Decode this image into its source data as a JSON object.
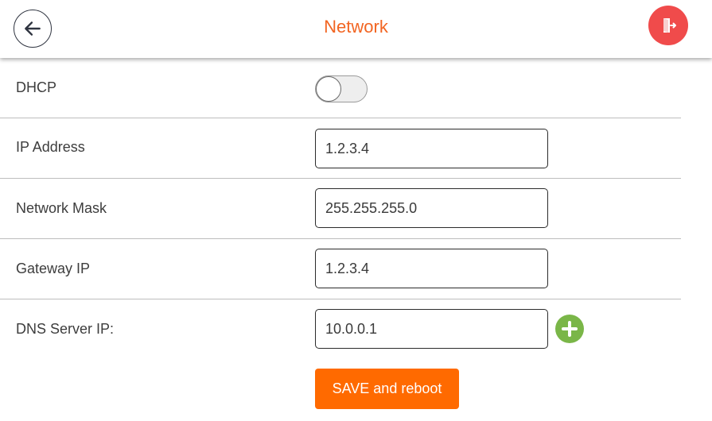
{
  "header": {
    "title": "Network",
    "back_icon": "arrow-left-icon",
    "logout_icon": "exit-door-icon",
    "title_color": "#f26522",
    "logout_color": "#f04b4b"
  },
  "form": {
    "dhcp": {
      "label": "DHCP",
      "enabled": false
    },
    "ip_address": {
      "label": "IP Address",
      "value": "1.2.3.4"
    },
    "network_mask": {
      "label": "Network Mask",
      "value": "255.255.255.0"
    },
    "gateway_ip": {
      "label": "Gateway IP",
      "value": "1.2.3.4"
    },
    "dns_server_ip": {
      "label": "DNS Server IP:",
      "value": "10.0.0.1",
      "add_icon": "plus-circle-icon",
      "add_color": "#7ab648"
    }
  },
  "actions": {
    "save_label": "SAVE and reboot",
    "save_color": "#ff6a00"
  }
}
